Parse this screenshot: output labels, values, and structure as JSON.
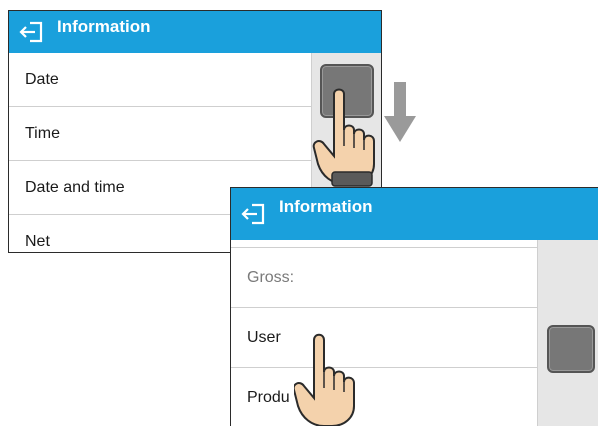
{
  "window_1": {
    "title": "Information",
    "items": [
      {
        "label": "Date"
      },
      {
        "label": "Time"
      },
      {
        "label": "Date and time"
      },
      {
        "label": "Net"
      }
    ]
  },
  "window_2": {
    "title": "Information",
    "items": [
      {
        "label": "Gross:"
      },
      {
        "label": "User"
      },
      {
        "label": "Produ"
      }
    ]
  },
  "icons": {
    "back": "back-arrow-icon",
    "hand": "pointing-hand-icon",
    "arrow": "down-arrow-icon"
  },
  "colors": {
    "header": "#1aa0dc",
    "scroll_thumb": "#777777",
    "scroll_track": "#e6e6e6"
  }
}
